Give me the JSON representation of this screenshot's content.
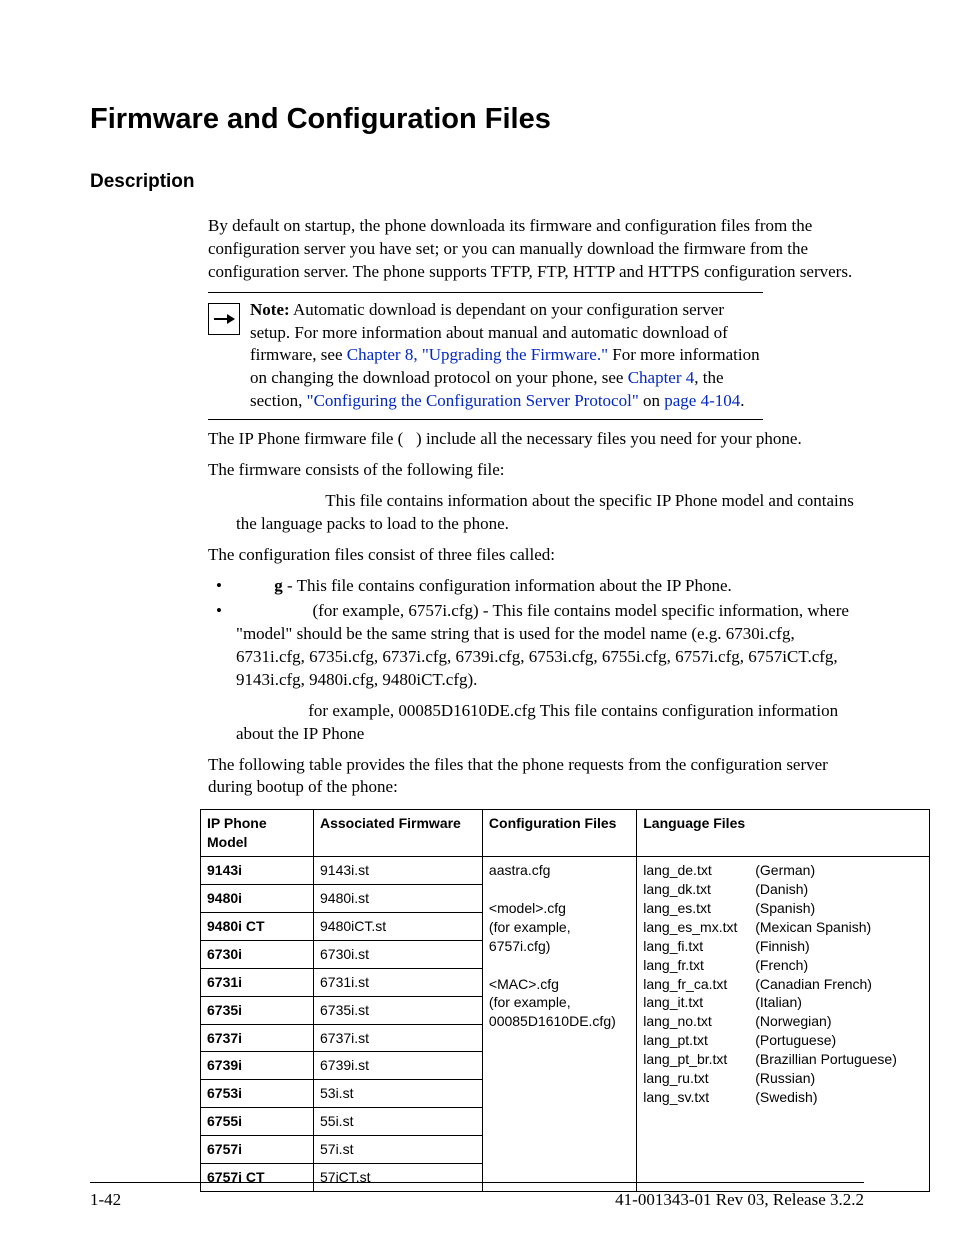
{
  "title": "Firmware and Configuration Files",
  "section": "Description",
  "intro": "By default on startup, the phone downloada its firmware and configuration files from the configuration server you have set; or you can manually download the firmware from the configuration server. The phone supports TFTP, FTP, HTTP and HTTPS configuration servers.",
  "note": {
    "lead": "Note:",
    "t1": " Automatic download is dependant on your configuration server setup. For more information about manual and automatic download of firmware, see ",
    "link1": "Chapter 8, \"Upgrading the Firmware.\"",
    "t2": " For more information on changing the download protocol on your phone, see ",
    "link2": "Chapter 4",
    "t3": ", the section, ",
    "link3": "\"Configuring the Configuration Server Protocol\"",
    "t4": " on ",
    "link4": "page 4-104",
    "t5": "."
  },
  "p2a": "The IP Phone firmware file (",
  "p2b": ") include all the necessary files you need for your phone.",
  "p3": "The firmware consists of the following file:",
  "p3b": "This file contains information about the specific IP Phone model and contains the language packs to load to the phone.",
  "p4": "The configuration files consist of three files called:",
  "bullets": {
    "b1_bold": "g",
    "b1_t": " - This file contains configuration information about the IP Phone.",
    "b2": " (for example, 6757i.cfg) - This file contains model specific information, where \"model\" should be the same string that is used for the model name (e.g. 6730i.cfg, 6731i.cfg, 6735i.cfg, 6737i.cfg, 6739i.cfg, 6753i.cfg, 6755i.cfg, 6757i.cfg, 6757iCT.cfg, 9143i.cfg, 9480i.cfg, 9480iCT.cfg).",
    "b3": "for example, 00085D1610DE.cfg     This file contains configuration information about the IP Phone"
  },
  "p5": "The following table provides the files that the phone requests from the configuration server during bootup of the phone:",
  "table": {
    "h1": "IP Phone Model",
    "h2": "Associated Firmware",
    "h3": "Configuration Files",
    "h4": "Language Files",
    "models": [
      {
        "m": "9143i",
        "f": "9143i.st"
      },
      {
        "m": "9480i",
        "f": "9480i.st"
      },
      {
        "m": "9480i CT",
        "f": "9480iCT.st"
      },
      {
        "m": "6730i",
        "f": "6730i.st"
      },
      {
        "m": "6731i",
        "f": "6731i.st"
      },
      {
        "m": "6735i",
        "f": "6735i.st"
      },
      {
        "m": "6737i",
        "f": "6737i.st"
      },
      {
        "m": "6739i",
        "f": "6739i.st"
      },
      {
        "m": "6753i",
        "f": "53i.st"
      },
      {
        "m": "6755i",
        "f": "55i.st"
      },
      {
        "m": "6757i",
        "f": "57i.st"
      },
      {
        "m": "6757i CT",
        "f": "57iCT.st"
      }
    ],
    "cfg_lines": [
      "aastra.cfg",
      "",
      "<model>.cfg",
      "(for example,",
      "6757i.cfg)",
      "",
      "<MAC>.cfg",
      "(for example,",
      "00085D1610DE.cfg)"
    ],
    "langs": [
      {
        "f": "lang_de.txt",
        "n": "(German)"
      },
      {
        "f": "lang_dk.txt",
        "n": "(Danish)"
      },
      {
        "f": "lang_es.txt",
        "n": "(Spanish)"
      },
      {
        "f": "lang_es_mx.txt",
        "n": "(Mexican Spanish)"
      },
      {
        "f": "lang_fi.txt",
        "n": "(Finnish)"
      },
      {
        "f": "lang_fr.txt",
        "n": "(French)"
      },
      {
        "f": "lang_fr_ca.txt",
        "n": "(Canadian French)"
      },
      {
        "f": "lang_it.txt",
        "n": "(Italian)"
      },
      {
        "f": "lang_no.txt",
        "n": "(Norwegian)"
      },
      {
        "f": "lang_pt.txt",
        "n": "(Portuguese)"
      },
      {
        "f": "lang_pt_br.txt",
        "n": "(Brazillian Portuguese)"
      },
      {
        "f": "lang_ru.txt",
        "n": "(Russian)"
      },
      {
        "f": "lang_sv.txt",
        "n": "(Swedish)"
      }
    ]
  },
  "footer": {
    "left": "1-42",
    "right": "41-001343-01 Rev 03, Release 3.2.2"
  }
}
